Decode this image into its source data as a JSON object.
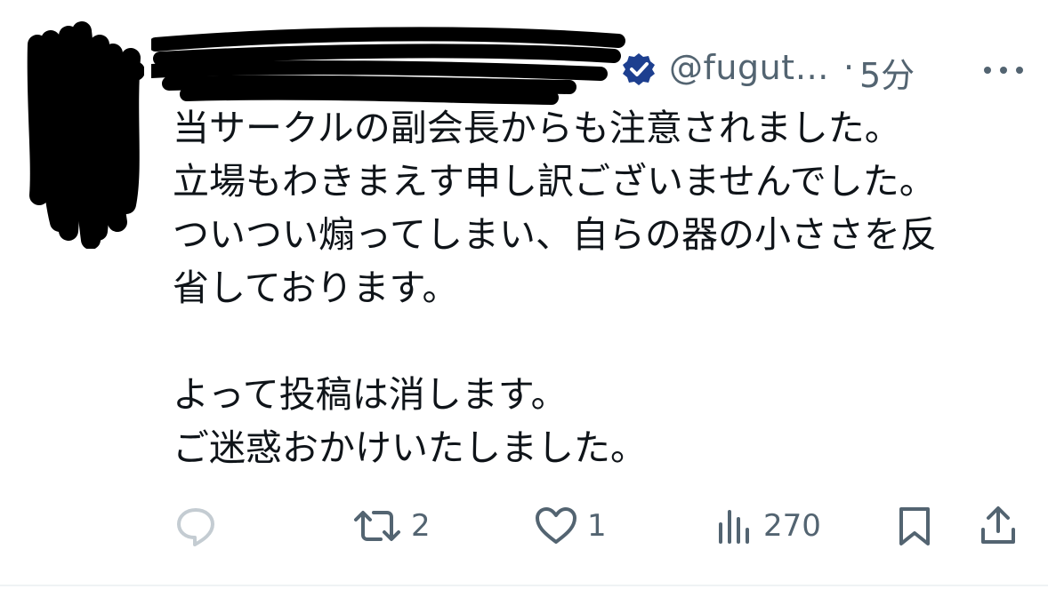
{
  "tweet": {
    "handle": "@fugut…",
    "dot": "·",
    "time": "5分",
    "lines": [
      "当サークルの副会長からも注意されました。",
      "立場もわきまえす申し訳ございませんでした。",
      "ついつい煽ってしまい、自らの器の小ささを反",
      "省しております。",
      "",
      "よって投稿は消します。",
      "ご迷惑おかけいたしました。"
    ],
    "actions": {
      "retweets": "2",
      "likes": "1",
      "views": "270"
    }
  },
  "icons": {
    "verified": "verified-badge-icon",
    "more": "more-options-icon",
    "reply": "reply-icon",
    "retweet": "retweet-icon",
    "like": "heart-icon",
    "views": "views-icon",
    "bookmark": "bookmark-icon",
    "share": "share-icon"
  },
  "colors": {
    "text": "#0f1419",
    "muted": "#536471",
    "verified": "#1d3f8f",
    "reply_icon": "#c4ccd2"
  }
}
